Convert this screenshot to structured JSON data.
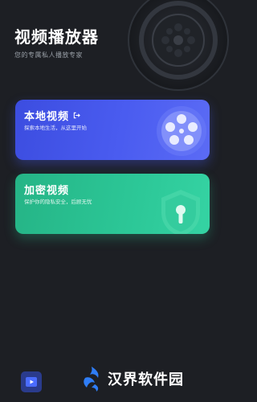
{
  "header": {
    "title": "视频播放器",
    "subtitle": "您的专属私人播放专家"
  },
  "cards": [
    {
      "title": "本地视频",
      "description": "探索本地生活，从这里开始",
      "icon": "film-reel-icon",
      "accent": "#4a5cf0"
    },
    {
      "title": "加密视频",
      "description": "保护你的隐私安全，后顾无忧",
      "icon": "shield-lock-icon",
      "accent": "#2cc797"
    }
  ],
  "bottom_nav": {
    "active_icon": "video-play-icon",
    "active_color": "#2a3b8c"
  },
  "watermark": {
    "text": "汉界软件园"
  },
  "colors": {
    "background": "#1d1f24"
  }
}
